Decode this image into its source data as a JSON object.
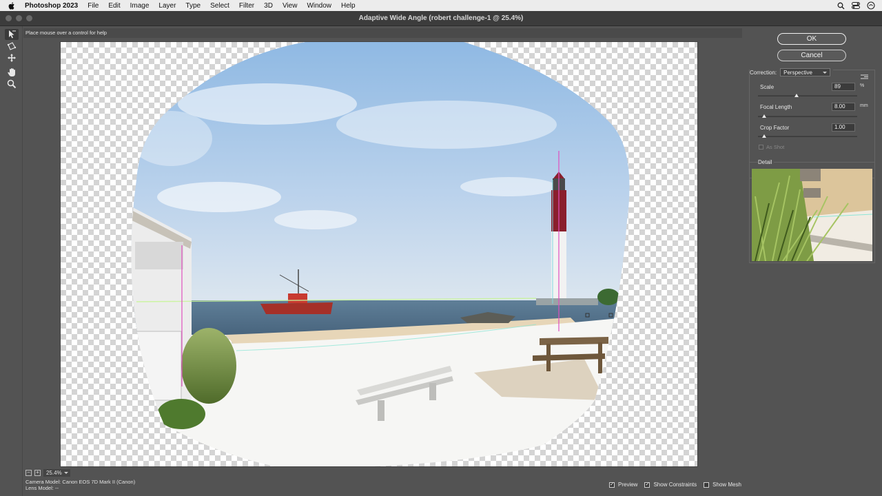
{
  "menubar": {
    "app_name": "Photoshop 2023",
    "items": [
      "File",
      "Edit",
      "Image",
      "Layer",
      "Type",
      "Select",
      "Filter",
      "3D",
      "View",
      "Window",
      "Help"
    ],
    "right_icons": [
      "search-icon",
      "control-center-icon",
      "siri-icon"
    ]
  },
  "window": {
    "title": "Adaptive Wide Angle (robert challenge-1 @ 25.4%)"
  },
  "help": {
    "text": "Place mouse over a control for help"
  },
  "tools": [
    "constraint-tool-icon",
    "polygon-constraint-tool-icon",
    "move-tool-icon",
    "hand-tool-icon",
    "zoom-tool-icon"
  ],
  "panel": {
    "ok_label": "OK",
    "cancel_label": "Cancel",
    "correction_label": "Correction:",
    "correction_value": "Perspective",
    "scale_label": "Scale",
    "scale_value": "89",
    "scale_unit": "%",
    "scale_pos": 0.39,
    "focal_label": "Focal Length",
    "focal_value": "8.00",
    "focal_unit": "mm",
    "focal_pos": 0.06,
    "crop_label": "Crop Factor",
    "crop_value": "1.00",
    "crop_pos": 0.06,
    "as_shot_label": "As Shot",
    "detail_label": "Detail"
  },
  "status": {
    "zoom_minus": "−",
    "zoom_plus": "+",
    "zoom": "25.4%",
    "camera_model": "Camera Model: Canon EOS 7D Mark II (Canon)",
    "lens_model": "Lens Model: --"
  },
  "checks": {
    "preview_label": "Preview",
    "preview_checked": true,
    "constraints_label": "Show Constraints",
    "constraints_checked": true,
    "mesh_label": "Show Mesh",
    "mesh_checked": false
  }
}
